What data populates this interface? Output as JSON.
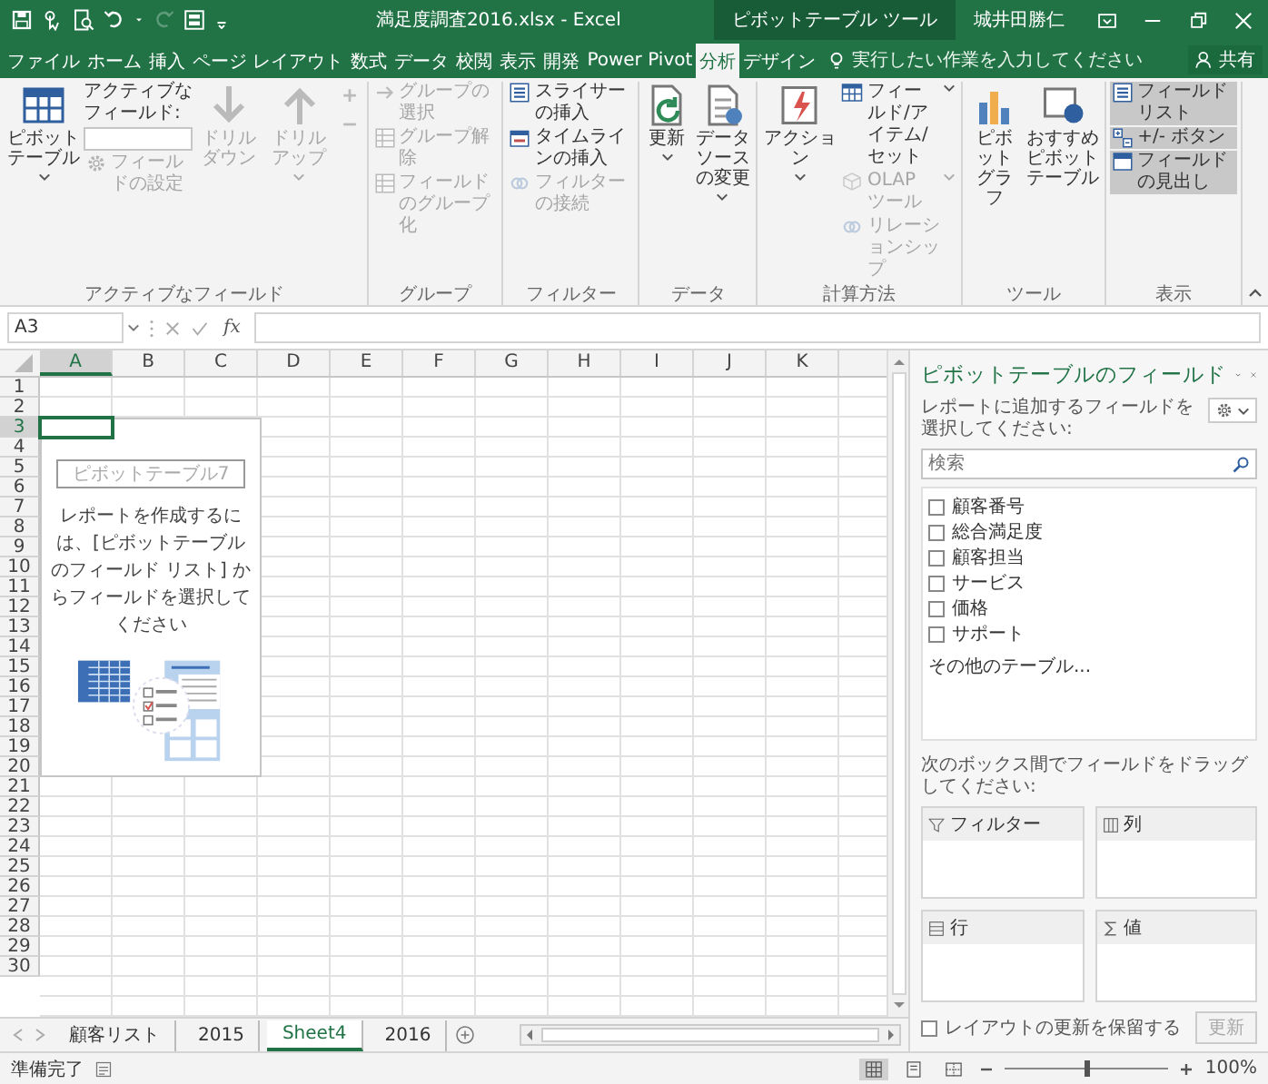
{
  "title_bar": {
    "title": "満足度調査2016.xlsx - Excel",
    "context_label": "ピボットテーブル ツール",
    "user": "城井田勝仁"
  },
  "tabs": [
    {
      "label": "ファイル",
      "selected": false
    },
    {
      "label": "ホーム",
      "selected": false
    },
    {
      "label": "挿入",
      "selected": false
    },
    {
      "label": "ページ レイアウト",
      "selected": false
    },
    {
      "label": "数式",
      "selected": false
    },
    {
      "label": "データ",
      "selected": false
    },
    {
      "label": "校閲",
      "selected": false
    },
    {
      "label": "表示",
      "selected": false
    },
    {
      "label": "開発",
      "selected": false
    },
    {
      "label": "Power Pivot",
      "selected": false
    },
    {
      "label": "分析",
      "selected": true
    },
    {
      "label": "デザイン",
      "selected": false
    }
  ],
  "tell_me": {
    "placeholder": "実行したい作業を入力してください"
  },
  "share": "共有",
  "ribbon": [
    {
      "label": "アクティブなフィールド",
      "items": [
        {
          "kind": "large",
          "label": "ピボットテーブル",
          "dropdown": true,
          "disabled": false
        },
        {
          "kind": "stack",
          "items": [
            {
              "kind": "caption",
              "label": "アクティブなフィールド:"
            },
            {
              "kind": "field"
            },
            {
              "kind": "small",
              "label": "フィールドの設定",
              "disabled": true
            }
          ]
        },
        {
          "kind": "large",
          "label": "ドリルダウン",
          "dropdown": false,
          "disabled": true
        },
        {
          "kind": "large",
          "label": "ドリルアップ",
          "dropdown": true,
          "disabled": true
        },
        {
          "kind": "stack",
          "items": [
            {
              "kind": "icon",
              "disabled": true
            },
            {
              "kind": "icon",
              "disabled": true
            }
          ]
        }
      ]
    },
    {
      "label": "グループ",
      "items": [
        {
          "kind": "stack",
          "items": [
            {
              "kind": "small",
              "label": "グループの選択",
              "disabled": true
            },
            {
              "kind": "small",
              "label": "グループ解除",
              "disabled": true
            },
            {
              "kind": "small",
              "label": "フィールドのグループ化",
              "disabled": true
            }
          ]
        }
      ]
    },
    {
      "label": "フィルター",
      "items": [
        {
          "kind": "stack",
          "items": [
            {
              "kind": "small",
              "label": "スライサーの挿入",
              "disabled": false
            },
            {
              "kind": "small",
              "label": "タイムラインの挿入",
              "disabled": false
            },
            {
              "kind": "small",
              "label": "フィルターの接続",
              "disabled": true
            }
          ]
        }
      ]
    },
    {
      "label": "データ",
      "items": [
        {
          "kind": "large",
          "label": "更新",
          "dropdown": true,
          "disabled": false
        },
        {
          "kind": "large",
          "label": "データソースの変更",
          "dropdown": true,
          "disabled": false
        }
      ]
    },
    {
      "label": "計算方法",
      "items": [
        {
          "kind": "large",
          "label": "アクション",
          "dropdown": true,
          "disabled": false
        },
        {
          "kind": "stack",
          "items": [
            {
              "kind": "small",
              "label": "フィールド/アイテム/セット",
              "dropdown": true,
              "disabled": false
            },
            {
              "kind": "small",
              "label": "OLAP ツール",
              "dropdown": true,
              "disabled": true
            },
            {
              "kind": "small",
              "label": "リレーションシップ",
              "disabled": true
            }
          ]
        }
      ]
    },
    {
      "label": "ツール",
      "items": [
        {
          "kind": "large",
          "label": "ピボットグラフ",
          "dropdown": false,
          "disabled": false
        },
        {
          "kind": "large",
          "label": "おすすめピボットテーブル",
          "dropdown": false,
          "disabled": false
        }
      ]
    },
    {
      "label": "表示",
      "items": [
        {
          "kind": "stack",
          "items": [
            {
              "kind": "small",
              "label": "フィールドリスト",
              "on": true,
              "disabled": false
            },
            {
              "kind": "small",
              "label": "+/- ボタン",
              "on": true,
              "disabled": false
            },
            {
              "kind": "small",
              "label": "フィールドの見出し",
              "on": true,
              "disabled": false
            }
          ]
        }
      ]
    }
  ],
  "formula_bar": {
    "name_box": "A3",
    "function_button": "fx"
  },
  "sheet": {
    "columns": [
      {
        "label": "A",
        "selected": true
      },
      {
        "label": "B",
        "selected": false
      },
      {
        "label": "C",
        "selected": false
      },
      {
        "label": "D",
        "selected": false
      },
      {
        "label": "E",
        "selected": false
      },
      {
        "label": "F",
        "selected": false
      },
      {
        "label": "G",
        "selected": false
      },
      {
        "label": "H",
        "selected": false
      },
      {
        "label": "I",
        "selected": false
      },
      {
        "label": "J",
        "selected": false
      },
      {
        "label": "K",
        "selected": false
      }
    ],
    "rows": [
      {
        "label": "1",
        "selected": false
      },
      {
        "label": "2",
        "selected": false
      },
      {
        "label": "3",
        "selected": true
      },
      {
        "label": "4",
        "selected": false
      },
      {
        "label": "5",
        "selected": false
      },
      {
        "label": "6",
        "selected": false
      },
      {
        "label": "7",
        "selected": false
      },
      {
        "label": "8",
        "selected": false
      },
      {
        "label": "9",
        "selected": false
      },
      {
        "label": "10",
        "selected": false
      },
      {
        "label": "11",
        "selected": false
      },
      {
        "label": "12",
        "selected": false
      },
      {
        "label": "13",
        "selected": false
      },
      {
        "label": "14",
        "selected": false
      },
      {
        "label": "15",
        "selected": false
      },
      {
        "label": "16",
        "selected": false
      },
      {
        "label": "17",
        "selected": false
      },
      {
        "label": "18",
        "selected": false
      },
      {
        "label": "19",
        "selected": false
      },
      {
        "label": "20",
        "selected": false
      },
      {
        "label": "21",
        "selected": false
      },
      {
        "label": "22",
        "selected": false
      },
      {
        "label": "23",
        "selected": false
      },
      {
        "label": "24",
        "selected": false
      },
      {
        "label": "25",
        "selected": false
      },
      {
        "label": "26",
        "selected": false
      },
      {
        "label": "27",
        "selected": false
      },
      {
        "label": "28",
        "selected": false
      },
      {
        "label": "29",
        "selected": false
      },
      {
        "label": "30",
        "selected": false
      }
    ],
    "pivot_placeholder": {
      "title": "ピボットテーブル7",
      "message": "レポートを作成するには、[ピボットテーブルのフィールド リスト] からフィールドを選択してください"
    }
  },
  "field_pane": {
    "title": "ピボットテーブルのフィールド",
    "instruction": "レポートに追加するフィールドを選択してください:",
    "search": {
      "placeholder": "検索"
    },
    "fields": [
      {
        "label": "顧客番号",
        "checked": false
      },
      {
        "label": "総合満足度",
        "checked": false
      },
      {
        "label": "顧客担当",
        "checked": false
      },
      {
        "label": "サービス",
        "checked": false
      },
      {
        "label": "価格",
        "checked": false
      },
      {
        "label": "サポート",
        "checked": false
      }
    ],
    "more_tables": "その他のテーブル...",
    "areas_instruction": "次のボックス間でフィールドをドラッグしてください:",
    "areas": [
      {
        "kind": "filters",
        "label": "フィルター"
      },
      {
        "kind": "columns",
        "label": "列"
      },
      {
        "kind": "rows",
        "label": "行"
      },
      {
        "kind": "values",
        "label": "値"
      }
    ],
    "defer": {
      "label": "レイアウトの更新を保留する",
      "checked": false
    },
    "update_button": {
      "label": "更新",
      "disabled": true
    }
  },
  "sheet_tabs": [
    {
      "label": "顧客リスト",
      "selected": false
    },
    {
      "label": "2015",
      "selected": false
    },
    {
      "label": "Sheet4",
      "selected": true
    },
    {
      "label": "2016",
      "selected": false
    }
  ],
  "status_bar": {
    "status": "準備完了",
    "views": [
      {
        "kind": "normal",
        "selected": true
      },
      {
        "kind": "page_layout",
        "selected": false
      },
      {
        "kind": "page_break",
        "selected": false
      }
    ],
    "zoom": {
      "level": 0.5,
      "reading": "100%"
    }
  }
}
